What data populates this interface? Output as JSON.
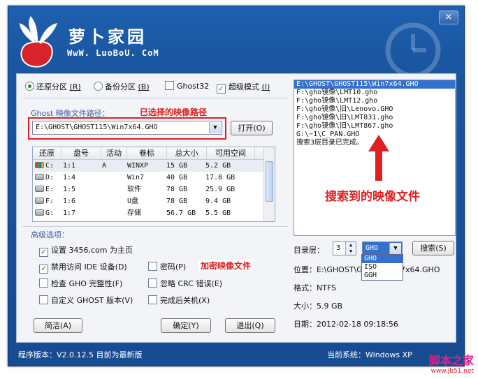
{
  "app": {
    "title": "萝卜家园",
    "url": "WwW. LuoBoU. CoM",
    "close_label": "×"
  },
  "mode": {
    "restore_label": "还原分区",
    "restore_key": "(R)",
    "backup_label": "备份分区",
    "backup_key": "(B)",
    "ghost32_label": "Ghost32",
    "super_label": "超级模式",
    "super_key": "(I)"
  },
  "image": {
    "path_label": "Ghost 映像文件路径：",
    "path_value": "E:\\GHOST\\GHOST115\\Win7x64.GHO",
    "open_button": "打开(O)",
    "note_selected": "已选择的映像路径"
  },
  "table": {
    "headers": [
      "还原",
      "盘号",
      "活动",
      "卷标",
      "总大小",
      "可用空间"
    ],
    "rows": [
      {
        "drive": "C:",
        "num": "1:1",
        "active": "A",
        "label": "WINXP",
        "total": "15 GB",
        "free": "5.2 GB"
      },
      {
        "drive": "D:",
        "num": "1:4",
        "active": "",
        "label": "Win7",
        "total": "40 GB",
        "free": "17.8 GB"
      },
      {
        "drive": "E:",
        "num": "1:5",
        "active": "",
        "label": "软件",
        "total": "78 GB",
        "free": "25.9 GB"
      },
      {
        "drive": "F:",
        "num": "1:6",
        "active": "",
        "label": "U盘",
        "total": "78 GB",
        "free": "9.4 GB"
      },
      {
        "drive": "G:",
        "num": "1:7",
        "active": "",
        "label": "存储",
        "total": "56.7 GB",
        "free": "5.5 GB"
      }
    ]
  },
  "advanced": {
    "title": "高级选项：",
    "homepage": "设置 3456.com 为主页",
    "disable_ide": "禁用访问 IDE 设备(D)",
    "password": "密码(P)",
    "encrypt_note": "加密映像文件",
    "check_gho": "检查 GHO 完整性(F)",
    "ignore_crc": "忽略 CRC 错误(E)",
    "custom_ghost": "自定义 GHOST 版本(V)",
    "shutdown": "完成后关机(X)"
  },
  "buttons": {
    "simple": "简洁(A)",
    "ok": "确定(Y)",
    "exit": "退出(Q)",
    "search": "搜索(S)"
  },
  "results": {
    "items": [
      "E:\\GHOST\\GHOST115\\Win7x64.GHO",
      "F:\\gho镜像\\LMT10.gho",
      "F:\\gho镜像\\LMT12.gho",
      "F:\\gho镜像\\旧\\Lenovo.GHO",
      "F:\\gho镜像\\旧\\LMT831.gho",
      "F:\\gho镜像\\旧\\LMT867.gho",
      "G:\\~1\\C_PAN.GHO",
      "搜索3层目录已完成。"
    ],
    "note_found": "搜索到的映像文件"
  },
  "search": {
    "level_label": "目录层：",
    "level_value": "3",
    "type_value": "GHO",
    "type_options": [
      "GHO",
      "ISO",
      "GGH"
    ]
  },
  "info": {
    "location_label": "位置：E:\\GHOST\\GH",
    "location_tail": "7x64.GHO",
    "format": "格式：NTFS",
    "size": "大小：5.9 GB",
    "date": "日期：2012-02-18   09:18:56"
  },
  "status": {
    "version": "程序版本：V2.0.12.5   目前为最新版",
    "system": "当前系统：Windows XP"
  },
  "watermark": {
    "name": "脚本之家",
    "url": "www.jb51.net"
  },
  "colors": {
    "window_blue": "#1a55a0",
    "note_red": "#e02020",
    "selection_blue": "#3470cc"
  }
}
